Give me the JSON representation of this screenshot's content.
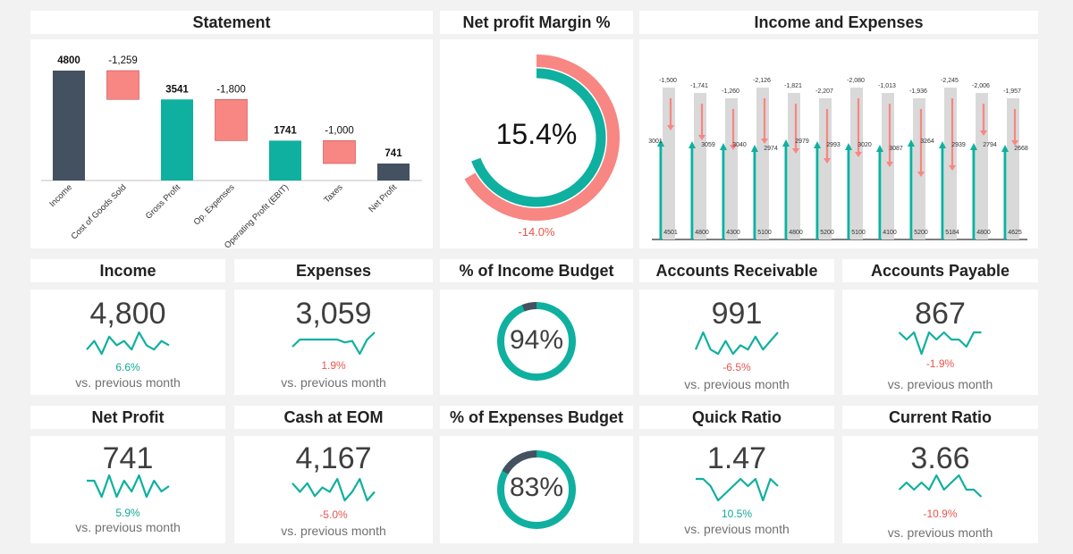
{
  "colors": {
    "dark": "#435161",
    "teal": "#0fb09f",
    "salmon": "#f88683",
    "grey": "#d9d9d9",
    "neg_text": "#e8554e",
    "pos_text": "#16a898"
  },
  "headers": {
    "statement": "Statement",
    "npm": "Net profit Margin %",
    "ie": "Income and Expenses"
  },
  "statement": {
    "type": "bar",
    "chart_data": {
      "type": "bar",
      "categories": [
        "Income",
        "Cost of Goods Sold",
        "Gross Profit",
        "Op. Expenses",
        "Operating Profit (EBIT)",
        "Taxes",
        "Net Profit"
      ],
      "values": [
        4800,
        -1259,
        3541,
        -1800,
        1741,
        -1000,
        741
      ],
      "labels": [
        "4800",
        "-1,259",
        "3541",
        "-1,800",
        "1741",
        "-1,000",
        "741"
      ],
      "ylim": [
        0,
        4800
      ]
    }
  },
  "npm": {
    "value_label": "15.4%",
    "prev_label": "-14.0%",
    "chart_data": {
      "type": "pie",
      "value": 15.4,
      "previous": -14.0
    }
  },
  "ie": {
    "chart_data": {
      "type": "bar",
      "income": [
        4501,
        4800,
        4300,
        5100,
        4800,
        5200,
        5100,
        4100,
        5200,
        5184,
        4800,
        4625
      ],
      "expenses": [
        3001,
        3059,
        3040,
        2974,
        2979,
        2993,
        3020,
        3087,
        3264,
        2939,
        2794,
        2668
      ],
      "diff_labels": [
        "-1,500",
        "-1,741",
        "-1,260",
        "-2,126",
        "-1,821",
        "-2,207",
        "-2,080",
        "-1,013",
        "-1,936",
        "-2,245",
        "-2,006",
        "-1,957"
      ],
      "ylim": [
        0,
        5200
      ]
    }
  },
  "kpis": {
    "income": {
      "title": "Income",
      "value": "4,800",
      "pct": "6.6%",
      "positive": true,
      "cmp": "vs. previous month",
      "spark": [
        3,
        5,
        2,
        6,
        4,
        5,
        3,
        7,
        4,
        3,
        5,
        4
      ]
    },
    "expenses": {
      "title": "Expenses",
      "value": "3,059",
      "pct": "1.9%",
      "positive": false,
      "cmp": "vs. previous month",
      "spark": [
        4,
        5,
        5,
        5,
        5,
        5,
        5,
        4.6,
        4.8,
        3,
        5,
        6
      ]
    },
    "ar": {
      "title": "Accounts Receivable",
      "value": "991",
      "pct": "-6.5%",
      "positive": false,
      "cmp": "vs. previous month",
      "spark": [
        3,
        7,
        3,
        2,
        5,
        2,
        4,
        3,
        6,
        3,
        5,
        7
      ]
    },
    "ap": {
      "title": "Accounts Payable",
      "value": "867",
      "pct": "-1.9%",
      "positive": false,
      "cmp": "vs. previous month",
      "spark": [
        5,
        4,
        5,
        2,
        5,
        4,
        5,
        4,
        4,
        3,
        5,
        5
      ]
    },
    "netprofit": {
      "title": "Net Profit",
      "value": "741",
      "pct": "5.9%",
      "positive": true,
      "cmp": "vs. previous month",
      "spark": [
        6,
        6,
        3,
        7,
        3,
        6,
        4,
        7,
        3,
        6,
        4,
        5
      ]
    },
    "cash": {
      "title": "Cash at EOM",
      "value": "4,167",
      "pct": "-5.0%",
      "positive": false,
      "cmp": "vs. previous month",
      "spark": [
        6,
        4,
        6,
        3,
        5,
        4,
        7,
        2,
        4,
        7,
        2,
        4
      ]
    },
    "quick": {
      "title": "Quick Ratio",
      "value": "1.47",
      "pct": "10.5%",
      "positive": true,
      "cmp": "vs. previous month",
      "spark": [
        6,
        6,
        5,
        3,
        4,
        5,
        6,
        5,
        6,
        3,
        6,
        5
      ]
    },
    "current": {
      "title": "Current Ratio",
      "value": "3.66",
      "pct": "-10.9%",
      "positive": false,
      "cmp": "vs. previous month",
      "spark": [
        4,
        5,
        4,
        5,
        4,
        6,
        4,
        5,
        6,
        4,
        4,
        3
      ]
    }
  },
  "budgets": {
    "income": {
      "title": "% of Income Budget",
      "label": "94%",
      "value": 94
    },
    "expenses": {
      "title": "% of Expenses Budget",
      "label": "83%",
      "value": 83
    }
  }
}
